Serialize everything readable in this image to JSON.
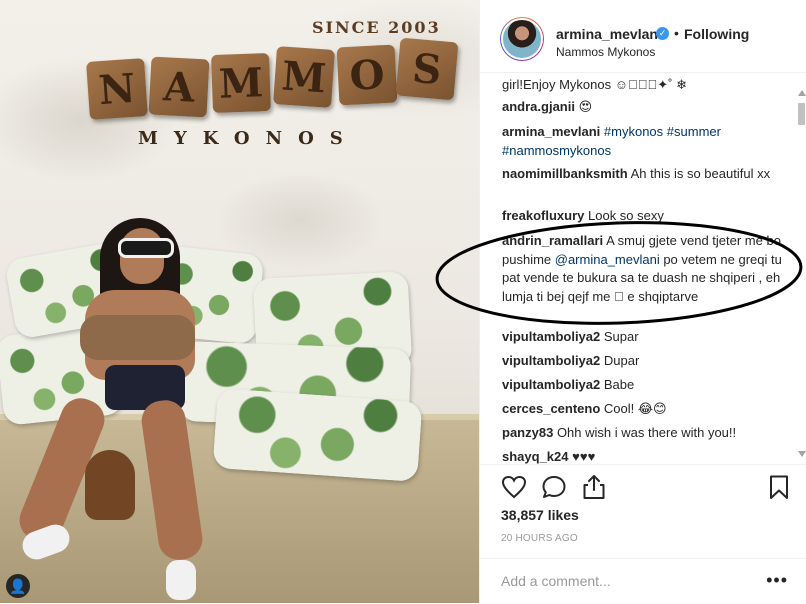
{
  "photo": {
    "sign_since": "SINCE 2003",
    "sign_letters": [
      "N",
      "A",
      "M",
      "M",
      "O",
      "S"
    ],
    "sign_subtitle": "MYKONOS"
  },
  "header": {
    "username": "armina_mevlani",
    "verified_glyph": "✓",
    "separator": "•",
    "follow_status": "Following",
    "location": "Nammos Mykonos"
  },
  "comments": [
    {
      "user": "",
      "text": "girl!Enjoy Mykonos ☺✧⃝⃝✦˚ ❄"
    },
    {
      "user": "andra.gjanii",
      "text": "😍"
    },
    {
      "user": "armina_mevlani",
      "text": "",
      "tags": [
        "#mykonos",
        "#summer",
        "#nammosmykonos"
      ]
    },
    {
      "user": "naomimillbanksmith",
      "text": "Ah this is so beautiful xx"
    },
    {
      "user": "freakofluxury",
      "text": "Look so sexy"
    },
    {
      "user": "andrin_ramallari",
      "text_before": "A smuj gjete vend tjeter me bo pushime ",
      "mention": "@armina_mevlani",
      "text_after": " po vetem ne greqi tu pat vende te bukura sa te duash ne shqiperi , eh lumja ti bej qejf me ⃞ e shqiptarve"
    },
    {
      "user": "vipultamboliya2",
      "text": "Supar"
    },
    {
      "user": "vipultamboliya2",
      "text": "Dupar"
    },
    {
      "user": "vipultamboliya2",
      "text": "Babe"
    },
    {
      "user": "cerces_centeno",
      "text": "Cool! 😂😊"
    },
    {
      "user": "panzy83",
      "text": "Ohh wish i was there with you!!"
    },
    {
      "user": "shayq_k24",
      "text": "♥♥♥"
    }
  ],
  "actions": {
    "likes": "38,857 likes",
    "time_ago": "20 HOURS AGO",
    "comment_placeholder": "Add a comment...",
    "more_glyph": "•••",
    "user_tag_glyph": "👤"
  },
  "colors": {
    "text": "#262626",
    "link": "#003569",
    "verified": "#3897f0",
    "muted": "#999999",
    "annotation": "#000000"
  }
}
